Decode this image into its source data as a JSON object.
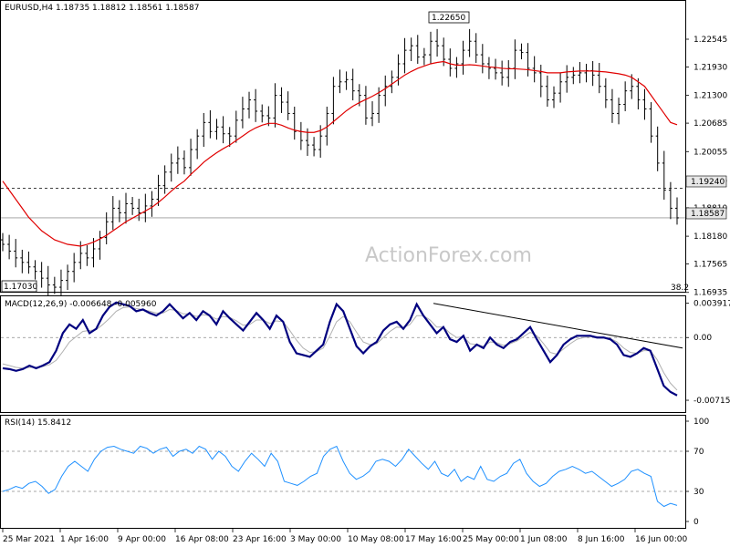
{
  "chart_data": {
    "type": "candlestick",
    "colors": {
      "price": "#000000",
      "ma": "#e00000",
      "macd": "#00007f",
      "signal": "#b0b0b0",
      "rsi": "#1e90ff",
      "grid": "#8a8a8a"
    },
    "price_panel": {
      "header": "EURUSD,H4  1.18735 1.18812 1.18561 1.18587",
      "ylim": [
        1.1695,
        1.2305
      ],
      "yticks": [
        "1.22545",
        "1.21930",
        "1.21300",
        "1.20685",
        "1.20055",
        "1.19425",
        "1.18810",
        "1.18180",
        "1.17565",
        "1.16935"
      ],
      "level_line": 1.1924,
      "level_label": "1.19240",
      "last_price": 1.18587,
      "last_label": "1.18587",
      "high_label": "1.22650",
      "low_label": "1.17030",
      "fib_label": "38.2",
      "watermark": "ActionForex.com",
      "series_close": [
        1.18,
        1.1785,
        1.177,
        1.176,
        1.175,
        1.174,
        1.1725,
        1.171,
        1.1705,
        1.172,
        1.174,
        1.176,
        1.178,
        1.177,
        1.179,
        1.1815,
        1.185,
        1.188,
        1.187,
        1.189,
        1.188,
        1.187,
        1.1885,
        1.19,
        1.193,
        1.196,
        1.198,
        1.199,
        1.197,
        1.201,
        1.204,
        1.207,
        1.205,
        1.206,
        1.2045,
        1.204,
        1.2075,
        1.21,
        1.212,
        1.2095,
        1.2085,
        1.208,
        1.213,
        1.2115,
        1.209,
        1.205,
        1.203,
        1.202,
        1.201,
        1.204,
        1.209,
        1.215,
        1.216,
        1.2165,
        1.214,
        1.213,
        1.208,
        1.209,
        1.213,
        1.215,
        1.217,
        1.22,
        1.223,
        1.224,
        1.2215,
        1.222,
        1.225,
        1.224,
        1.221,
        1.219,
        1.22,
        1.223,
        1.225,
        1.222,
        1.22,
        1.219,
        1.218,
        1.217,
        1.219,
        1.223,
        1.2225,
        1.219,
        1.218,
        1.215,
        1.212,
        1.2135,
        1.216,
        1.217,
        1.2175,
        1.218,
        1.2185,
        1.2175,
        1.215,
        1.212,
        1.209,
        1.211,
        1.214,
        1.215,
        1.212,
        1.21,
        1.204,
        1.198,
        1.192,
        1.188,
        1.18587
      ],
      "series_ma": [
        1.194,
        1.192,
        1.19,
        1.188,
        1.186,
        1.1845,
        1.183,
        1.182,
        1.181,
        1.1805,
        1.18,
        1.1798,
        1.1796,
        1.18,
        1.1805,
        1.1812,
        1.182,
        1.183,
        1.184,
        1.185,
        1.1858,
        1.1866,
        1.1874,
        1.1882,
        1.1893,
        1.1905,
        1.1918,
        1.193,
        1.194,
        1.1955,
        1.1968,
        1.1982,
        1.1993,
        1.2003,
        1.2012,
        1.202,
        1.203,
        1.204,
        1.205,
        1.2058,
        1.2064,
        1.2068,
        1.2068,
        1.2064,
        1.2058,
        1.2053,
        1.205,
        1.2048,
        1.2048,
        1.2052,
        1.206,
        1.2072,
        1.2084,
        1.2096,
        1.2106,
        1.2114,
        1.2121,
        1.2128,
        1.2136,
        1.2145,
        1.2155,
        1.2165,
        1.2175,
        1.2183,
        1.219,
        1.2195,
        1.22,
        1.2203,
        1.2205,
        1.22,
        1.2197,
        1.2197,
        1.2198,
        1.2197,
        1.2195,
        1.2193,
        1.2192,
        1.219,
        1.2189,
        1.2189,
        1.2188,
        1.2187,
        1.2185,
        1.2183,
        1.218,
        1.218,
        1.218,
        1.2182,
        1.2183,
        1.2184,
        1.2184,
        1.2184,
        1.2183,
        1.2182,
        1.218,
        1.2178,
        1.2175,
        1.217,
        1.216,
        1.215,
        1.213,
        1.211,
        1.209,
        1.207,
        1.2065
      ]
    },
    "macd_panel": {
      "header": "MACD(12,26,9) -0.006648 -0.005960",
      "ylim": [
        -0.0085,
        0.0046
      ],
      "yticks": [
        "0.003917",
        "0.00",
        "-0.007152"
      ],
      "trendline": [
        0.0039,
        -0.0012
      ],
      "macd": [
        -0.0035,
        -0.0036,
        -0.0038,
        -0.0036,
        -0.0032,
        -0.0035,
        -0.0032,
        -0.0028,
        -0.0015,
        0.0005,
        0.0015,
        0.001,
        0.002,
        0.0005,
        0.001,
        0.0025,
        0.0035,
        0.004,
        0.0038,
        0.0036,
        0.003,
        0.0032,
        0.0028,
        0.0025,
        0.003,
        0.0038,
        0.003,
        0.0022,
        0.0028,
        0.002,
        0.003,
        0.0025,
        0.0015,
        0.003,
        0.0022,
        0.0015,
        0.0008,
        0.0018,
        0.0028,
        0.002,
        0.001,
        0.0025,
        0.0018,
        -0.0005,
        -0.0018,
        -0.002,
        -0.0022,
        -0.0015,
        -0.0008,
        0.0018,
        0.0038,
        0.003,
        0.001,
        -0.001,
        -0.0018,
        -0.001,
        -0.0005,
        0.0008,
        0.0015,
        0.0018,
        0.001,
        0.002,
        0.0038,
        0.0025,
        0.0015,
        0.0005,
        0.0012,
        -0.0002,
        -0.0005,
        0.0002,
        -0.0015,
        -0.0008,
        -0.0012,
        0.0,
        -0.0008,
        -0.0012,
        -0.0005,
        -0.0002,
        0.0005,
        0.0012,
        -0.0002,
        -0.0015,
        -0.0028,
        -0.002,
        -0.0008,
        -0.0002,
        0.0002,
        0.0002,
        0.0002,
        0.0,
        0.0,
        -0.0002,
        -0.0008,
        -0.002,
        -0.0022,
        -0.0018,
        -0.0012,
        -0.0015,
        -0.0035,
        -0.0055,
        -0.0062,
        -0.0066
      ],
      "signal": [
        -0.003,
        -0.0032,
        -0.0034,
        -0.0035,
        -0.0034,
        -0.0034,
        -0.0033,
        -0.0031,
        -0.0026,
        -0.0016,
        -0.0005,
        0.0001,
        0.0007,
        0.0008,
        0.0009,
        0.0015,
        0.0022,
        0.003,
        0.0034,
        0.0035,
        0.0033,
        0.0032,
        0.003,
        0.0028,
        0.0028,
        0.0032,
        0.0031,
        0.0027,
        0.0027,
        0.0024,
        0.0026,
        0.0025,
        0.0021,
        0.0024,
        0.0023,
        0.0019,
        0.0014,
        0.0015,
        0.002,
        0.002,
        0.0016,
        0.0019,
        0.0018,
        0.0008,
        -0.0003,
        -0.0012,
        -0.0017,
        -0.0016,
        -0.0012,
        0.0002,
        0.0018,
        0.0024,
        0.0018,
        0.0006,
        -0.0005,
        -0.0008,
        -0.0007,
        0.0,
        0.0007,
        0.0012,
        0.0011,
        0.0015,
        0.0025,
        0.0025,
        0.002,
        0.0012,
        0.0012,
        0.0005,
        0.0,
        0.0001,
        -0.0007,
        -0.0008,
        -0.001,
        -0.0005,
        -0.0006,
        -0.0009,
        -0.0007,
        -0.0004,
        0.0001,
        0.0006,
        0.0002,
        -0.0007,
        -0.0017,
        -0.0019,
        -0.0013,
        -0.0007,
        -0.0002,
        0.0,
        0.0001,
        0.0001,
        0.0,
        -0.0001,
        -0.0005,
        -0.0012,
        -0.0017,
        -0.0018,
        -0.0015,
        -0.0015,
        -0.0025,
        -0.004,
        -0.0052,
        -0.006
      ]
    },
    "rsi_panel": {
      "header": "RSI(14) 15.8412",
      "ylim": [
        0,
        100
      ],
      "yticks": [
        "100",
        "70",
        "30",
        "0"
      ],
      "levels": [
        70,
        30
      ],
      "values": [
        30,
        32,
        35,
        33,
        38,
        40,
        35,
        28,
        32,
        45,
        55,
        60,
        55,
        50,
        62,
        70,
        74,
        75,
        72,
        70,
        68,
        75,
        73,
        68,
        72,
        74,
        65,
        70,
        72,
        68,
        75,
        72,
        62,
        70,
        65,
        55,
        50,
        60,
        68,
        62,
        55,
        68,
        60,
        40,
        38,
        36,
        40,
        45,
        48,
        65,
        72,
        75,
        60,
        48,
        42,
        45,
        50,
        60,
        62,
        60,
        55,
        62,
        72,
        65,
        58,
        52,
        60,
        48,
        45,
        52,
        40,
        45,
        42,
        55,
        42,
        40,
        45,
        48,
        58,
        62,
        48,
        40,
        35,
        38,
        45,
        50,
        52,
        55,
        52,
        48,
        50,
        45,
        40,
        35,
        38,
        42,
        50,
        52,
        48,
        45,
        20,
        15,
        18,
        16
      ],
      "value_label": "15.8412"
    },
    "xaxis": {
      "tick_labels": [
        "25 Mar 2021",
        "1 Apr 16:00",
        "9 Apr 00:00",
        "16 Apr 08:00",
        "23 Apr 16:00",
        "3 May 00:00",
        "10 May 08:00",
        "17 May 16:00",
        "25 May 00:00",
        "1 Jun 08:00",
        "8 Jun 16:00",
        "16 Jun 00:00"
      ]
    }
  }
}
